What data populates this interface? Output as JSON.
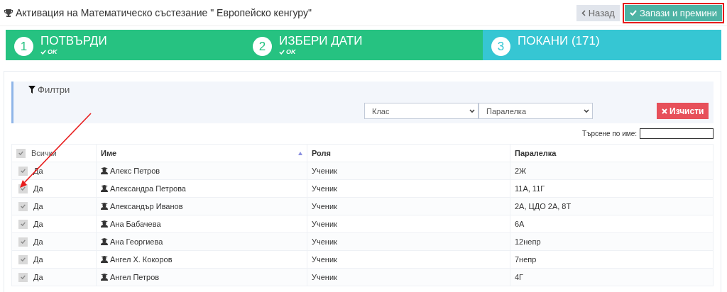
{
  "header": {
    "title": "Активация на Математическо състезание \" Европейско кенгуру\"",
    "buttons": [
      {
        "label": "Назад",
        "kind": "back",
        "highlighted": false
      },
      {
        "label": "Запази и премини",
        "kind": "save",
        "highlighted": true
      }
    ]
  },
  "steps": [
    {
      "number": "1",
      "title": "ПОТВЪРДИ",
      "status": "OK",
      "done": true
    },
    {
      "number": "2",
      "title": "ИЗБЕРИ ДАТИ",
      "status": "OK",
      "done": true
    },
    {
      "number": "3",
      "title": "ПОКАНИ (171)",
      "done": false
    }
  ],
  "filters": {
    "title": "Филтри",
    "selects": [
      {
        "value": "Клас"
      },
      {
        "value": "Паралелка"
      }
    ],
    "clear_button": "Изчисти"
  },
  "search": {
    "label": "Търсене по име:"
  },
  "table": {
    "columns": [
      {
        "label": "Всички",
        "kind": "check",
        "checked": true
      },
      {
        "label": "Име",
        "kind": "text",
        "sorted": true
      },
      {
        "label": "Роля",
        "kind": "text",
        "sorted": false
      },
      {
        "label": "Паралелка",
        "kind": "text",
        "sorted": false
      }
    ],
    "rows": [
      {
        "checked": true,
        "included": "Да",
        "name": "Алекс Петров",
        "role": "Ученик",
        "class": "2Ж"
      },
      {
        "checked": true,
        "included": "Да",
        "name": "Александра Петрова",
        "role": "Ученик",
        "class": "11А, 11Г"
      },
      {
        "checked": true,
        "included": "Да",
        "name": "Александър Иванов",
        "role": "Ученик",
        "class": "2А, ЦДО 2А, 8Т"
      },
      {
        "checked": true,
        "included": "Да",
        "name": "Ана Бабачева",
        "role": "Ученик",
        "class": "6А"
      },
      {
        "checked": true,
        "included": "Да",
        "name": "Ана Георгиева",
        "role": "Ученик",
        "class": "12непр"
      },
      {
        "checked": true,
        "included": "Да",
        "name": "Ангел Х. Кокоров",
        "role": "Ученик",
        "class": "7непр"
      },
      {
        "checked": true,
        "included": "Да",
        "name": "Ангел Петров",
        "role": "Ученик",
        "class": "4Г"
      }
    ]
  },
  "annotations": [
    {
      "kind": "arrow"
    }
  ]
}
